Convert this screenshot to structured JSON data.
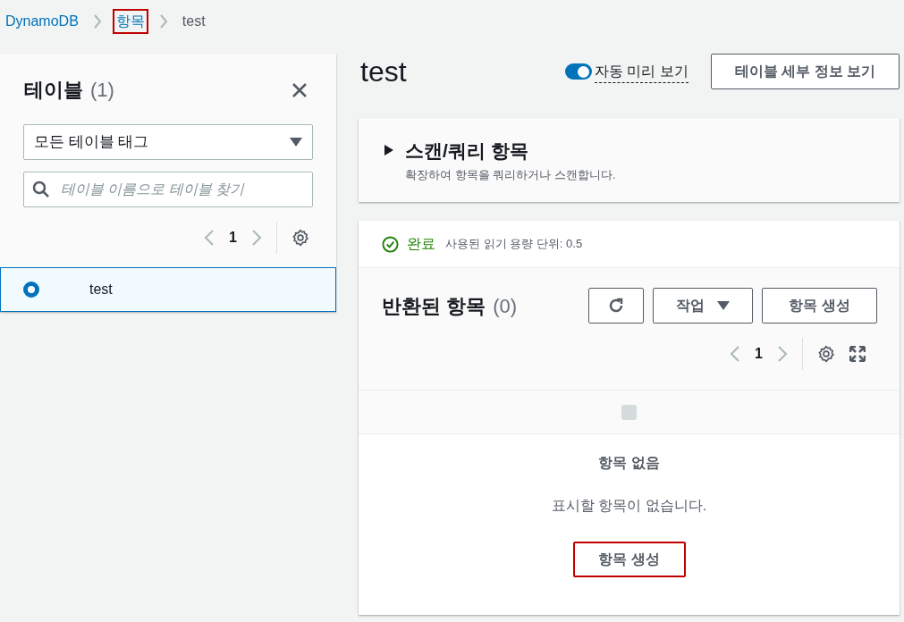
{
  "breadcrumbs": [
    {
      "label": "DynamoDB",
      "kind": "link",
      "highlighted": false
    },
    {
      "label": "항목",
      "kind": "link",
      "highlighted": true
    },
    {
      "label": "test",
      "kind": "current",
      "highlighted": false
    }
  ],
  "sidebar": {
    "title": "테이블",
    "count": "(1)",
    "tag_filter": "모든 테이블 태그",
    "search": {
      "placeholder": "테이블 이름으로 테이블 찾기"
    },
    "page": "1",
    "tables": [
      {
        "name": "test",
        "selected": true
      }
    ]
  },
  "main": {
    "title": "test",
    "auto_preview": {
      "label": "자동 미리 보기",
      "on": true
    },
    "details_button": "테이블 세부 정보 보기",
    "scan_panel": {
      "title": "스캔/쿼리 항목",
      "description": "확장하여 항목을 쿼리하거나 스캔합니다.",
      "expanded": false
    },
    "status": {
      "label": "완료",
      "detail": "사용된 읽기 용량 단위: 0.5"
    },
    "results": {
      "title": "반환된 항목",
      "count": "(0)",
      "actions_button": "작업",
      "create_button": {
        "label": "항목 생성",
        "highlighted": false
      },
      "page": "1",
      "select_all": {
        "checked": false,
        "disabled": true
      },
      "empty_title": "항목 없음",
      "empty_text": "표시할 항목이 없습니다.",
      "empty_button": {
        "label": "항목 생성",
        "highlighted": true
      }
    }
  }
}
